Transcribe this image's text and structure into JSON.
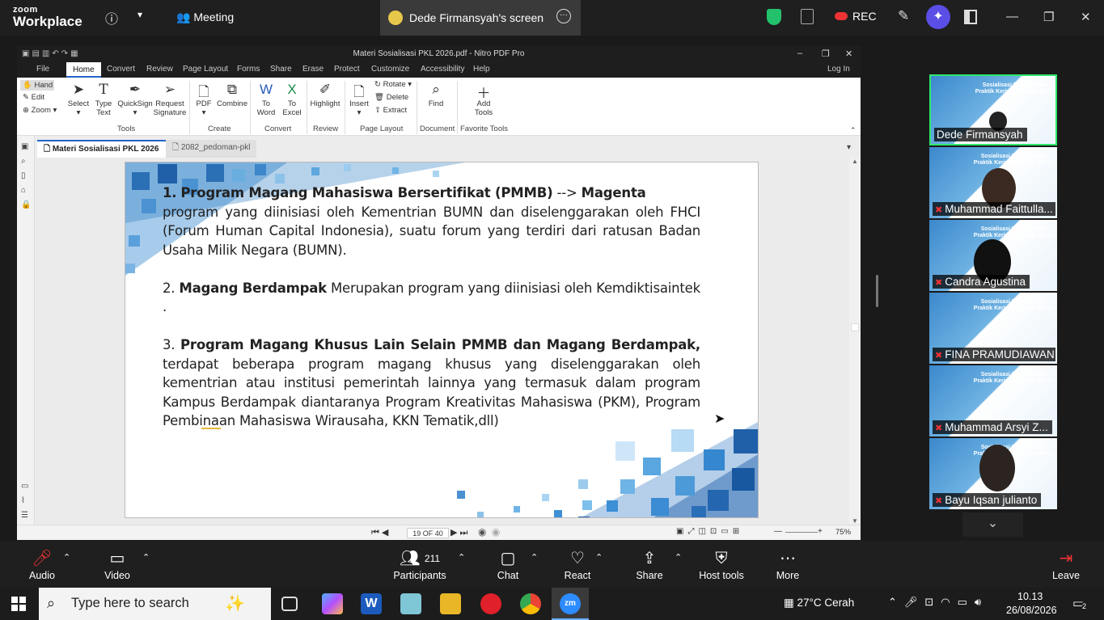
{
  "zoom": {
    "brand_top": "zoom",
    "brand_bottom": "Workplace",
    "meeting_label": "Meeting",
    "screen_share_label": "Dede Firmansyah's screen",
    "rec_label": "REC",
    "toolbar": {
      "audio": "Audio",
      "video": "Video",
      "participants": "Participants",
      "participants_count": "211",
      "chat": "Chat",
      "react": "React",
      "share": "Share",
      "host_tools": "Host tools",
      "more": "More",
      "leave": "Leave"
    }
  },
  "nitro": {
    "window_title": "Materi Sosialisasi PKL 2026.pdf - Nitro PDF Pro",
    "menu": [
      "File",
      "Home",
      "Convert",
      "Review",
      "Page Layout",
      "Forms",
      "Share",
      "Erase",
      "Protect",
      "Customize",
      "Accessibility",
      "Help"
    ],
    "login": "Log In",
    "ribbon": {
      "hand": "Hand",
      "edit": "Edit",
      "zoom": "Zoom",
      "select": "Select",
      "type_text": [
        "Type",
        "Text"
      ],
      "quicksign": "QuickSign",
      "request_signature": [
        "Request",
        "Signature"
      ],
      "pdf": "PDF",
      "combine": "Combine",
      "to_word": [
        "To",
        "Word"
      ],
      "to_excel": [
        "To",
        "Excel"
      ],
      "highlight": "Highlight",
      "insert": "Insert",
      "rotate": "Rotate",
      "delete": "Delete",
      "extract": "Extract",
      "find": "Find",
      "add_tools": [
        "Add",
        "Tools"
      ],
      "groups": {
        "tools": "Tools",
        "create": "Create",
        "convert": "Convert",
        "review": "Review",
        "page_layout": "Page Layout",
        "document": "Document",
        "favorite_tools": "Favorite Tools"
      }
    },
    "tabs": [
      {
        "label": "Materi Sosialisasi PKL 2026",
        "active": true
      },
      {
        "label": "2082_pedoman-pkl",
        "active": false
      }
    ],
    "page_indicator": "19 OF 40",
    "zoom_level": "75%"
  },
  "slide": {
    "item1_num": "1.",
    "item1_title": "Program Magang Mahasiswa Bersertifikat (PMMB)",
    "item1_arrow": " --> ",
    "item1_magenta": "Magenta",
    "item1_body": "program yang diinisiasi oleh Kementrian BUMN dan diselenggarakan oleh FHCI (Forum Human Capital Indonesia), suatu forum yang terdiri dari ratusan Badan Usaha Milik Negara (BUMN).",
    "item2_num": "2.",
    "item2_title": "Magang Berdampak",
    "item2_body": " Merupakan program yang diinisiasi oleh Kemdiktisaintek .",
    "item3_num": "3.",
    "item3_title": "Program Magang Khusus Lain Selain PMMB dan Magang Berdampak,",
    "item3_body": " terdapat beberapa program magang khusus yang diselenggarakan oleh kementrian atau institusi pemerintah lainnya yang termasuk dalam program Kampus Berdampak diantaranya Program Kreativitas Mahasiswa (PKM), Program Pembinaan Mahasiswa Wirausaha, KKN Tematik,dll)"
  },
  "participants": {
    "slide_header": "Sosialisasi Pelaksanaan Praktik Kerja Lapangan (PKL)",
    "tiles": [
      {
        "name": "Dede Firmansyah",
        "muted": false
      },
      {
        "name": "Muhammad Faittulla...",
        "muted": true
      },
      {
        "name": "Candra Agustina",
        "muted": true
      },
      {
        "name": "FINA PRAMUDIAWAN",
        "muted": true
      },
      {
        "name": "Muhammad Arsyi Z...",
        "muted": true
      },
      {
        "name": "Bayu Iqsan julianto",
        "muted": true
      }
    ]
  },
  "taskbar": {
    "search_placeholder": "Type here to search",
    "weather": "27°C  Cerah",
    "time": "10.13",
    "date": "26/08/2026",
    "notifications": "2"
  }
}
